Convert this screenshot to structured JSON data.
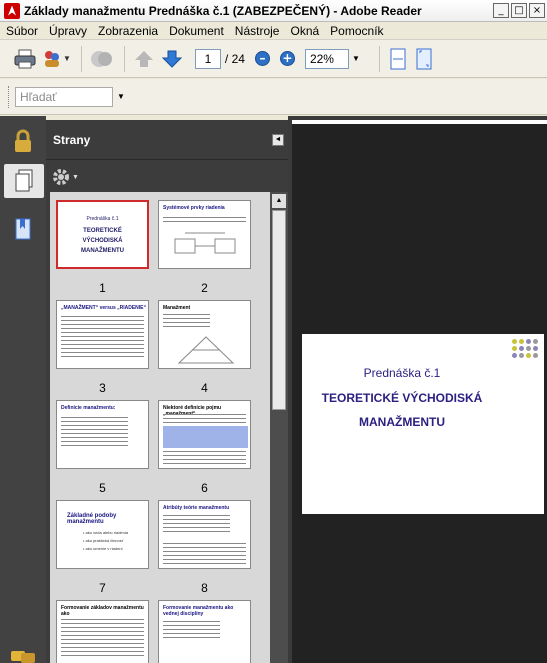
{
  "window": {
    "title": "Základy manažmentu Prednáška č.1 (ZABEZPEČENÝ) - Adobe Reader",
    "min": "_",
    "max": "□",
    "close": "×"
  },
  "menu": [
    "Súbor",
    "Úpravy",
    "Zobrazenia",
    "Dokument",
    "Nástroje",
    "Okná",
    "Pomocník"
  ],
  "toolbar": {
    "page_current": "1",
    "page_total": "/ 24",
    "zoom": "22%",
    "zoom_out": "–",
    "zoom_in": "+"
  },
  "find": {
    "placeholder": "Hľadať"
  },
  "panel": {
    "title": "Strany"
  },
  "thumbnails": [
    {
      "num": "1",
      "title_small": "Prednáška č.1",
      "title": "TEORETICKÉ VÝCHODISKÁ MANAŽMENTU"
    },
    {
      "num": "2",
      "title": "Systémové prvky riadenia"
    },
    {
      "num": "3",
      "title": "„MANAŽMENT“ versus „RIADENIE“"
    },
    {
      "num": "4",
      "title": "Manažment"
    },
    {
      "num": "5",
      "title": "Definície manažmentu:"
    },
    {
      "num": "6",
      "title": "Niektoré definície pojmu „manažment“"
    },
    {
      "num": "7",
      "title": "Základné podoby manažmentu"
    },
    {
      "num": "8",
      "title": "Atribúty teórie manažmentu"
    },
    {
      "num": "",
      "title": "Formovanie základov manažmentu ako"
    },
    {
      "num": "",
      "title": "Formovanie manažmentu ako vednej disciplíny"
    }
  ],
  "thumb7_items": [
    "ako veda alebo riadenia",
    "ako praktická činnosť",
    "ako umenie v riadení"
  ],
  "page": {
    "subtitle": "Prednáška č.1",
    "title_line1": "TEORETICKÉ VÝCHODISKÁ",
    "title_line2": "MANAŽMENTU"
  },
  "colors": {
    "dot_yellow": "#c9c23a",
    "dot_purple": "#8c86b8",
    "dot_gray": "#9a9a9a",
    "accent": "#2c2080"
  }
}
